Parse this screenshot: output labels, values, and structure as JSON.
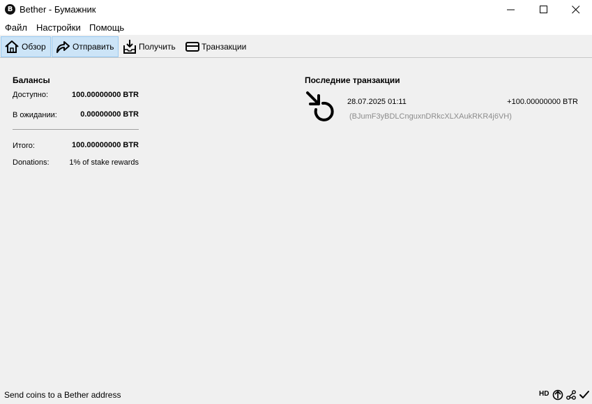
{
  "window": {
    "title": "Bether - Бумажник",
    "app_icon_letter": "B"
  },
  "menu": [
    "Файл",
    "Настройки",
    "Помощь"
  ],
  "toolbar": {
    "overview": "Обзор",
    "send": "Отправить",
    "receive": "Получить",
    "transactions": "Транзакции"
  },
  "balances": {
    "title": "Балансы",
    "available_label": "Доступно:",
    "available_value": "100.00000000 BTR",
    "pending_label": "В ожидании:",
    "pending_value": "0.00000000 BTR",
    "total_label": "Итого:",
    "total_value": "100.00000000 BTR",
    "donations_label": "Donations:",
    "donations_value": "1% of stake rewards"
  },
  "recent": {
    "title": "Последние транзакции",
    "items": [
      {
        "date": "28.07.2025 01:11",
        "amount": "+100.00000000 BTR",
        "address": "(BJumF3yBDLCnguxnDRkcXLXAukRKR4j6VH)",
        "icon": "stake-incoming-icon"
      }
    ]
  },
  "status": {
    "text": "Send coins to a Bether address",
    "hd": "HD"
  }
}
